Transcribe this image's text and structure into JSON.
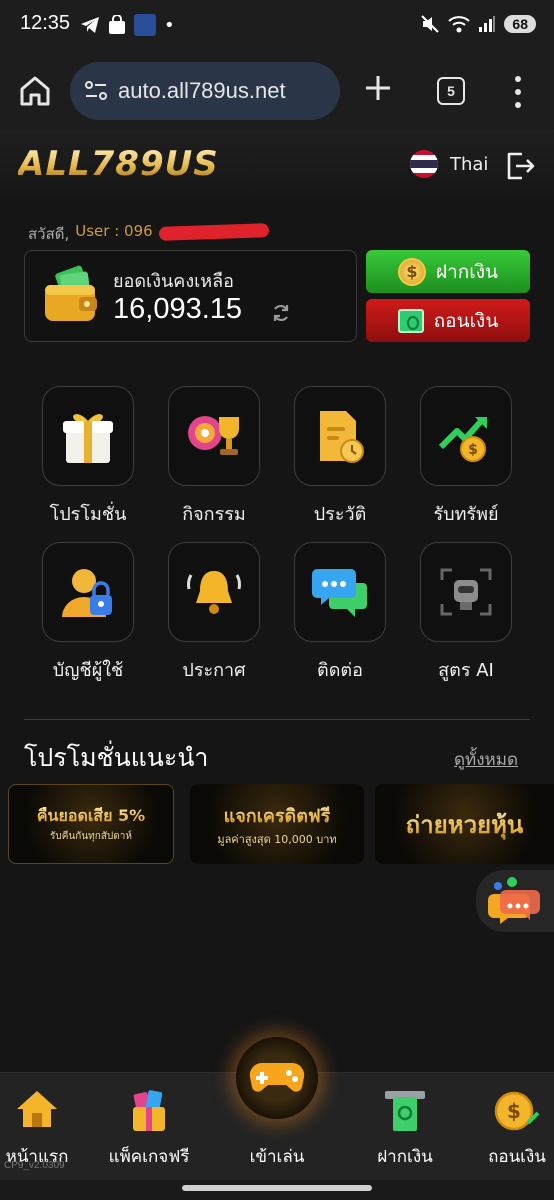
{
  "status_bar": {
    "time": "12:35",
    "dot": "•",
    "battery": "68"
  },
  "browser": {
    "url": "auto.all789us.net",
    "tab_count": "5"
  },
  "header": {
    "logo": "ALL789US",
    "language": "Thai"
  },
  "greeting": {
    "hello": "สวัสดี,",
    "user_prefix": "User : 096"
  },
  "balance": {
    "label": "ยอดเงินคงเหลือ",
    "value": "16,093.15"
  },
  "actions": {
    "deposit": "ฝากเงิน",
    "withdraw": "ถอนเงิน"
  },
  "menu": [
    {
      "label": "โปรโมชั่น",
      "icon": "gift-icon"
    },
    {
      "label": "กิจกรรม",
      "icon": "trophy-wheel-icon"
    },
    {
      "label": "ประวัติ",
      "icon": "history-document-icon"
    },
    {
      "label": "รับทรัพย์",
      "icon": "money-growth-icon"
    },
    {
      "label": "บัญชีผู้ใช้",
      "icon": "user-lock-icon"
    },
    {
      "label": "ประกาศ",
      "icon": "bell-icon"
    },
    {
      "label": "ติดต่อ",
      "icon": "chat-bubbles-icon"
    },
    {
      "label": "สูตร AI",
      "icon": "robot-icon"
    }
  ],
  "promotions": {
    "title": "โปรโมชั่นแนะนำ",
    "see_all": "ดูทั้งหมด",
    "banners": [
      {
        "title": "คืนยอดเสีย 5%",
        "subtitle": "รับคืนกันทุกสัปดาห์"
      },
      {
        "title": "แจกเครดิตฟรี",
        "subtitle": "มูลค่าสูงสุด 10,000 บาท"
      },
      {
        "title": "ถ่ายหวยหุ้น",
        "subtitle": ""
      }
    ]
  },
  "bottom_nav": {
    "home": "หน้าแรก",
    "packages": "แพ็คเกจฟรี",
    "play": "เข้าเล่น",
    "deposit": "ฝากเงิน",
    "withdraw": "ถอนเงิน"
  },
  "version": "CP9_v2.0309",
  "colors": {
    "accent_gold": "#e8b94a",
    "deposit_green": "#2fb52f",
    "withdraw_red": "#b81414",
    "background": "#151515"
  }
}
